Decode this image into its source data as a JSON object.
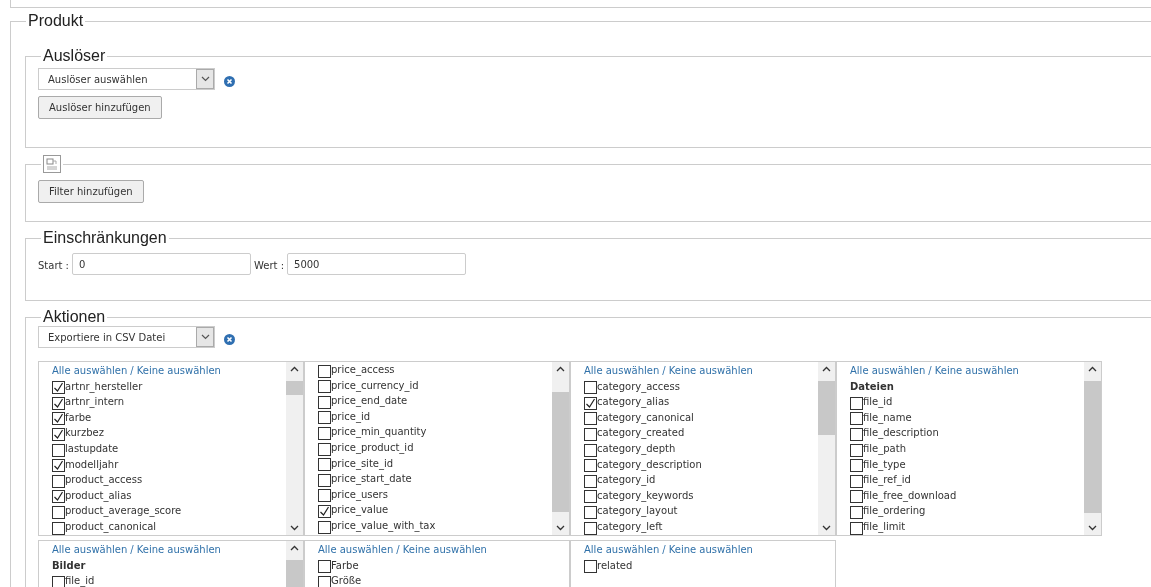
{
  "section": {
    "legend": "Produkt"
  },
  "trigger": {
    "legend": "Auslöser",
    "select": {
      "value": "Auslöser auswählen"
    },
    "add_button": "Auslöser hinzufügen"
  },
  "filter": {
    "add_button": "Filter hinzufügen"
  },
  "restrictions": {
    "legend": "Einschränkungen",
    "fields": [
      {
        "label": "Start :",
        "value": "0"
      },
      {
        "label": "Wert :",
        "value": "5000"
      }
    ]
  },
  "actions": {
    "legend": "Aktionen",
    "select": {
      "value": "Exportiere in CSV Datei"
    },
    "panels": [
      {
        "select_all": "Alle auswählen",
        "separator": "/",
        "select_none": "Keine auswählen",
        "scrollable": true,
        "items": [
          {
            "kind": "checkbox",
            "label": "artnr_hersteller",
            "checked": true
          },
          {
            "kind": "checkbox",
            "label": "artnr_intern",
            "checked": true
          },
          {
            "kind": "checkbox",
            "label": "farbe",
            "checked": true
          },
          {
            "kind": "checkbox",
            "label": "kurzbez",
            "checked": true
          },
          {
            "kind": "checkbox",
            "label": "lastupdate",
            "checked": false
          },
          {
            "kind": "checkbox",
            "label": "modelljahr",
            "checked": true
          },
          {
            "kind": "checkbox",
            "label": "product_access",
            "checked": false
          },
          {
            "kind": "checkbox",
            "label": "product_alias",
            "checked": true
          },
          {
            "kind": "checkbox",
            "label": "product_average_score",
            "checked": false
          },
          {
            "kind": "checkbox",
            "label": "product_canonical",
            "checked": false
          }
        ]
      },
      {
        "scrollable": true,
        "items": [
          {
            "kind": "checkbox",
            "label": "price_access",
            "checked": false
          },
          {
            "kind": "checkbox",
            "label": "price_currency_id",
            "checked": false
          },
          {
            "kind": "checkbox",
            "label": "price_end_date",
            "checked": false
          },
          {
            "kind": "checkbox",
            "label": "price_id",
            "checked": false
          },
          {
            "kind": "checkbox",
            "label": "price_min_quantity",
            "checked": false
          },
          {
            "kind": "checkbox",
            "label": "price_product_id",
            "checked": false
          },
          {
            "kind": "checkbox",
            "label": "price_site_id",
            "checked": false
          },
          {
            "kind": "checkbox",
            "label": "price_start_date",
            "checked": false
          },
          {
            "kind": "checkbox",
            "label": "price_users",
            "checked": false
          },
          {
            "kind": "checkbox",
            "label": "price_value",
            "checked": true
          },
          {
            "kind": "checkbox",
            "label": "price_value_with_tax",
            "checked": false
          }
        ]
      },
      {
        "select_all": "Alle auswählen",
        "separator": "/",
        "select_none": "Keine auswählen",
        "scrollable": true,
        "items": [
          {
            "kind": "checkbox",
            "label": "category_access",
            "checked": false
          },
          {
            "kind": "checkbox",
            "label": "category_alias",
            "checked": true
          },
          {
            "kind": "checkbox",
            "label": "category_canonical",
            "checked": false
          },
          {
            "kind": "checkbox",
            "label": "category_created",
            "checked": false
          },
          {
            "kind": "checkbox",
            "label": "category_depth",
            "checked": false
          },
          {
            "kind": "checkbox",
            "label": "category_description",
            "checked": false
          },
          {
            "kind": "checkbox",
            "label": "category_id",
            "checked": false
          },
          {
            "kind": "checkbox",
            "label": "category_keywords",
            "checked": false
          },
          {
            "kind": "checkbox",
            "label": "category_layout",
            "checked": false
          },
          {
            "kind": "checkbox",
            "label": "category_left",
            "checked": false
          }
        ]
      },
      {
        "select_all": "Alle auswählen",
        "separator": "/",
        "select_none": "Keine auswählen",
        "scrollable": true,
        "items": [
          {
            "kind": "heading",
            "label": "Dateien"
          },
          {
            "kind": "checkbox",
            "label": "file_id",
            "checked": false
          },
          {
            "kind": "checkbox",
            "label": "file_name",
            "checked": false
          },
          {
            "kind": "checkbox",
            "label": "file_description",
            "checked": false
          },
          {
            "kind": "checkbox",
            "label": "file_path",
            "checked": false
          },
          {
            "kind": "checkbox",
            "label": "file_type",
            "checked": false
          },
          {
            "kind": "checkbox",
            "label": "file_ref_id",
            "checked": false
          },
          {
            "kind": "checkbox",
            "label": "file_free_download",
            "checked": false
          },
          {
            "kind": "checkbox",
            "label": "file_ordering",
            "checked": false
          },
          {
            "kind": "checkbox",
            "label": "file_limit",
            "checked": false
          }
        ]
      },
      {
        "select_all": "Alle auswählen",
        "separator": "/",
        "select_none": "Keine auswählen",
        "scrollable": true,
        "items": [
          {
            "kind": "heading",
            "label": "Bilder"
          },
          {
            "kind": "checkbox",
            "label": "file_id",
            "checked": false
          }
        ]
      },
      {
        "select_all": "Alle auswählen",
        "separator": "/",
        "select_none": "Keine auswählen",
        "scrollable": false,
        "items": [
          {
            "kind": "checkbox",
            "label": "Farbe",
            "checked": false
          },
          {
            "kind": "checkbox",
            "label": "Größe",
            "checked": false
          }
        ]
      },
      {
        "select_all": "Alle auswählen",
        "separator": "/",
        "select_none": "Keine auswählen",
        "scrollable": false,
        "items": [
          {
            "kind": "checkbox",
            "label": "related",
            "checked": false
          }
        ]
      }
    ]
  }
}
